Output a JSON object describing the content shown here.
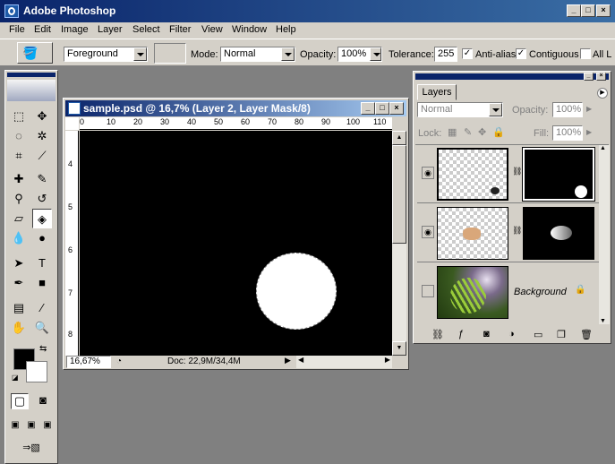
{
  "window": {
    "title": "Adobe Photoshop",
    "controls": [
      "_",
      "□",
      "×"
    ]
  },
  "menu": [
    "File",
    "Edit",
    "Image",
    "Layer",
    "Select",
    "Filter",
    "View",
    "Window",
    "Help"
  ],
  "options": {
    "fill_source": "Foreground",
    "mode_label": "Mode:",
    "mode_value": "Normal",
    "opacity_label": "Opacity:",
    "opacity_value": "100%",
    "tolerance_label": "Tolerance:",
    "tolerance_value": "255",
    "antialias_label": "Anti-alias",
    "contiguous_label": "Contiguous",
    "all_layers_label": "All L"
  },
  "document": {
    "title": "sample.psd @ 16,7% (Layer 2, Layer Mask/8)",
    "ruler_h": [
      "0",
      "10",
      "20",
      "30",
      "40",
      "50",
      "60",
      "70",
      "80",
      "90",
      "100",
      "110"
    ],
    "ruler_v": [
      "4",
      "5",
      "6",
      "7",
      "8"
    ],
    "zoom": "16,67%",
    "doc_size": "Doc: 22,9M/34,4M"
  },
  "layers_panel": {
    "tab": "Layers",
    "blend_mode": "Normal",
    "opacity_label": "Opacity:",
    "opacity_value": "100%",
    "lock_label": "Lock:",
    "fill_label": "Fill:",
    "fill_value": "100%",
    "background_name": "Background"
  },
  "colors": {
    "title_blue": "#0a246a",
    "panel_gray": "#d4d0c8",
    "workspace": "#808080"
  }
}
